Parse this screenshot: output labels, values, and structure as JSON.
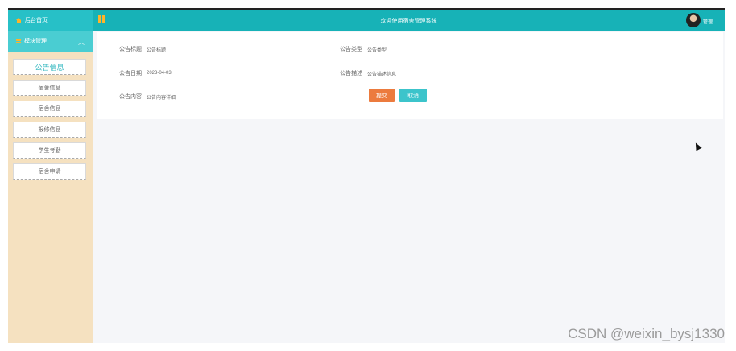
{
  "sidebar": {
    "home_label": "后台首页",
    "module_label": "模块管理",
    "chevron": "︿",
    "items": [
      {
        "label": "公告信息",
        "active": true
      },
      {
        "label": "宿舍信息"
      },
      {
        "label": "宿舍信息"
      },
      {
        "label": "报修信息"
      },
      {
        "label": "学生考勤"
      },
      {
        "label": "宿舍申请"
      }
    ]
  },
  "header": {
    "title": "欢迎使用宿舍管理系统",
    "username": "管理"
  },
  "form": {
    "title_label": "公告标题",
    "title_value": "公告标题",
    "type_label": "公告类型",
    "type_value": "公告类型",
    "date_label": "公告日期",
    "date_value": "2023-04-03",
    "desc_label": "公告描述",
    "desc_value": "公告描述信息",
    "content_label": "公告内容",
    "content_value": "公告内容详细",
    "submit_label": "提交",
    "cancel_label": "取消"
  },
  "watermark": "CSDN @weixin_bysj1330",
  "colors": {
    "topbar": "#17b2b7",
    "sidebar_bg": "#f5e1c0",
    "submit": "#ec7b3e",
    "cancel": "#3cc4cb",
    "icon_accent": "#ffb42a"
  },
  "icons": [
    "home-icon",
    "module-icon",
    "grid-icon",
    "avatar",
    "cursor-icon"
  ]
}
